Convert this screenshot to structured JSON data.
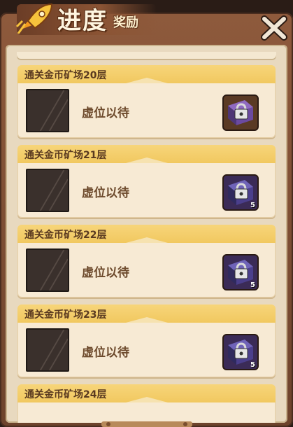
{
  "header": {
    "title_main": "进度",
    "title_sub": "奖励"
  },
  "placeholder_text": "虚位以待",
  "levels": [
    {
      "title": "通关金币矿场20层",
      "reward_count": ""
    },
    {
      "title": "通关金币矿场21层",
      "reward_count": "5"
    },
    {
      "title": "通关金币矿场22层",
      "reward_count": "5"
    },
    {
      "title": "通关金币矿场23层",
      "reward_count": "5"
    },
    {
      "title": "通关金币矿场24层",
      "reward_count": ""
    }
  ],
  "colors": {
    "header_band": "#f3cd66",
    "card_bg": "#f7ead4",
    "panel_bg": "#e8d9bf",
    "frame": "#7a4a30",
    "reward_bg": "#3b2b57"
  }
}
